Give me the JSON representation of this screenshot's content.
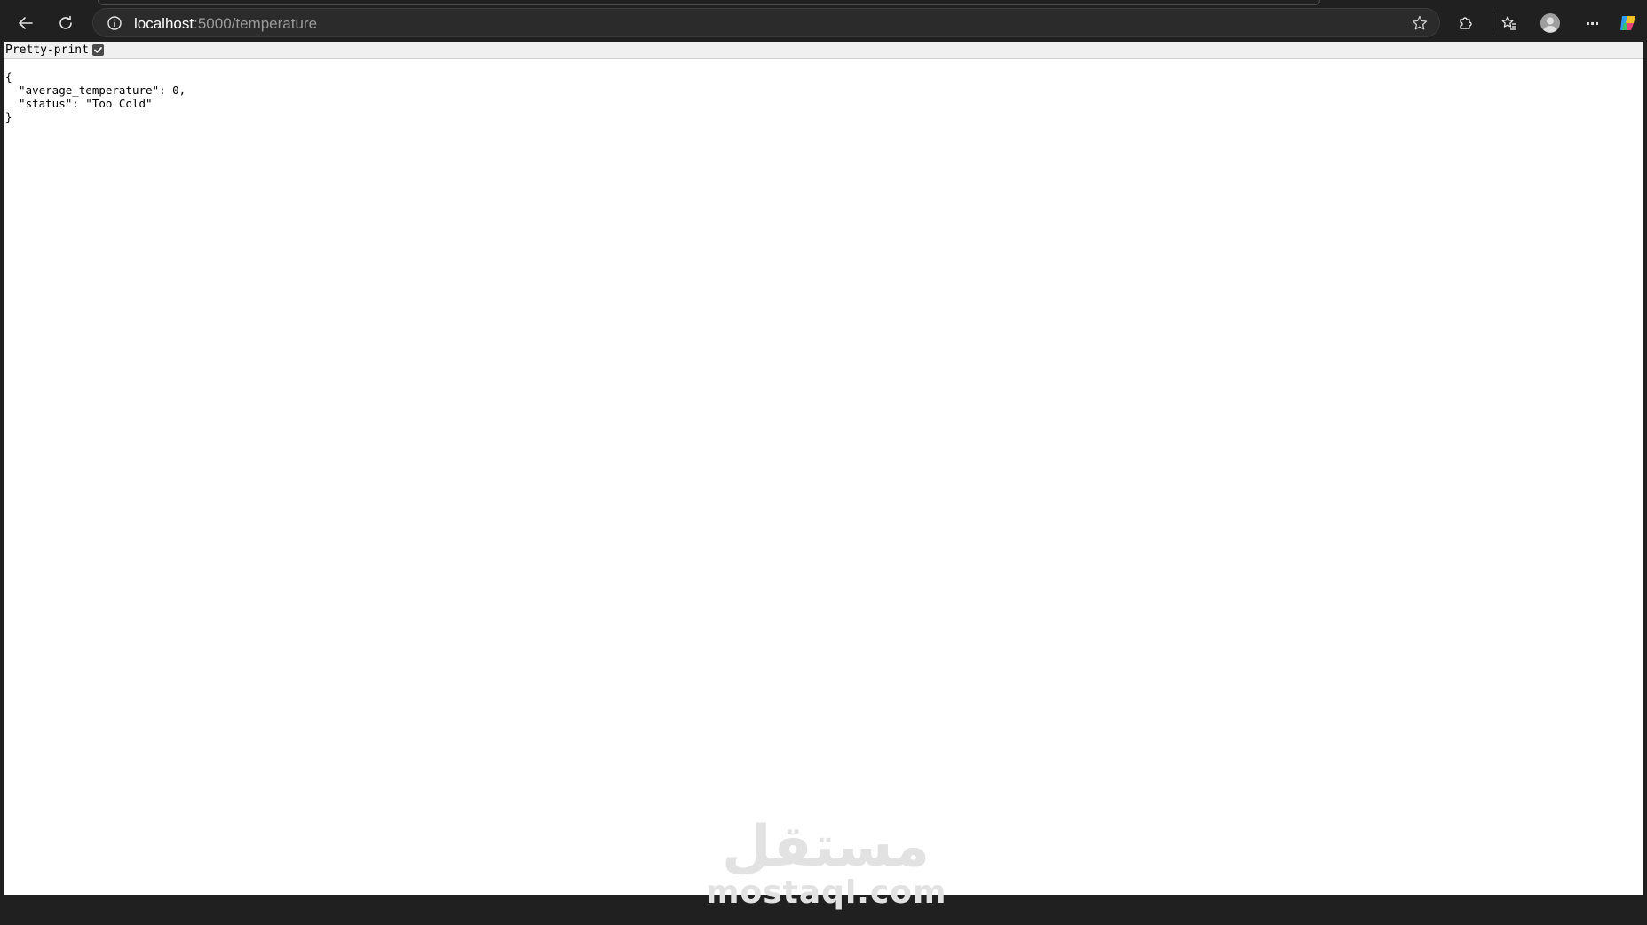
{
  "browser": {
    "url_host": "localhost",
    "url_path": ":5000/temperature",
    "icons": {
      "back": "arrow-left-icon",
      "reload": "reload-icon",
      "info": "info-icon",
      "favorite": "star-icon",
      "extensions": "puzzle-icon",
      "favorites": "favorites-icon",
      "profile": "profile-icon",
      "menu": "ellipsis-icon",
      "copilot": "copilot-icon"
    },
    "menu_glyph": "···"
  },
  "page": {
    "pretty_print_label": "Pretty-print",
    "pretty_print_checked": true,
    "json_text": "{\n  \"average_temperature\": 0,\n  \"status\": \"Too Cold\"\n}"
  },
  "watermark": {
    "arabic": "مستقل",
    "latin": "mostaql.com"
  }
}
